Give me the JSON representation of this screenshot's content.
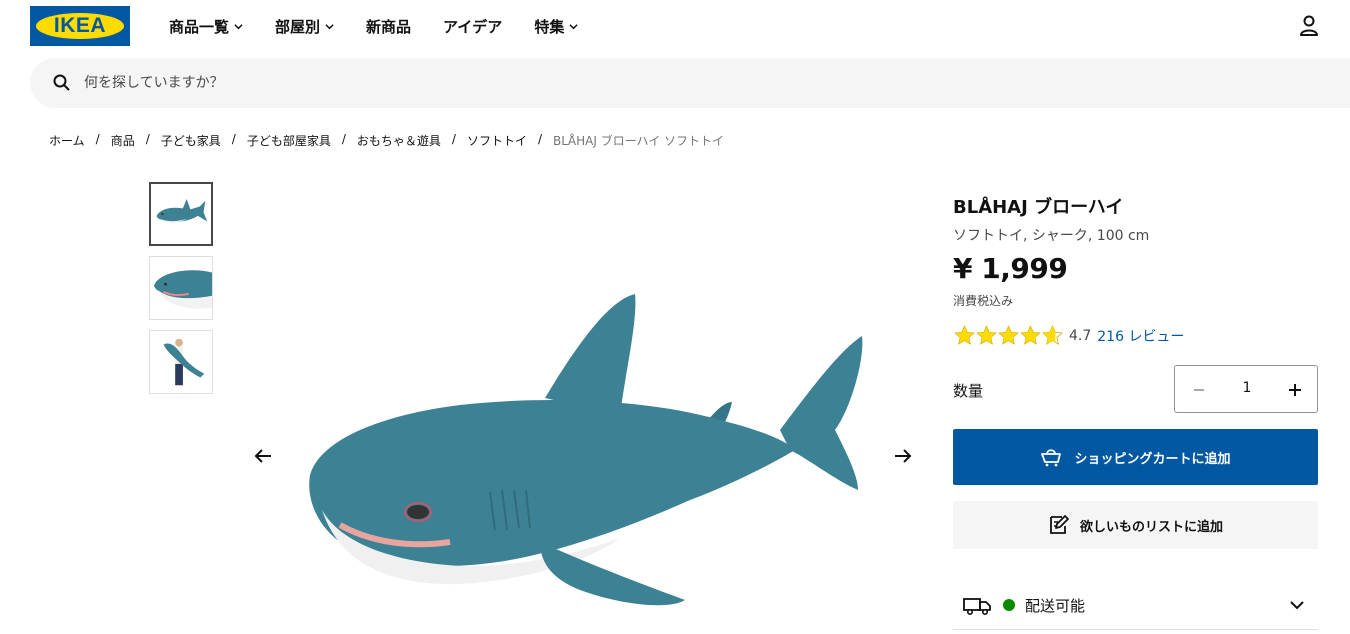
{
  "header": {
    "logo_text": "IKEA",
    "nav": [
      {
        "label": "商品一覧",
        "has_dropdown": true
      },
      {
        "label": "部屋別",
        "has_dropdown": true
      },
      {
        "label": "新商品",
        "has_dropdown": false
      },
      {
        "label": "アイデア",
        "has_dropdown": false
      },
      {
        "label": "特集",
        "has_dropdown": true
      }
    ],
    "user_icon": "user-icon"
  },
  "search": {
    "placeholder": "何を探していますか？",
    "icon": "search-icon"
  },
  "breadcrumb": [
    "ホーム",
    "商品",
    "子ども家具",
    "子ども部屋家具",
    "おもちゃ＆遊具",
    "ソフトトイ",
    "BLÅHAJ ブローハイ ソフトトイ"
  ],
  "gallery": {
    "thumbnails": [
      "shark-side-view",
      "shark-mouth-closeup",
      "person-holding-shark"
    ],
    "active_index": 0,
    "prev_icon": "arrow-left-icon",
    "next_icon": "arrow-right-icon"
  },
  "product": {
    "name": "BLÅHAJ ブローハイ",
    "description": "ソフトトイ, シャーク, 100 cm",
    "price": "¥ 1,999",
    "tax_note": "消費税込み",
    "rating_value": "4.7",
    "rating_stars": 4.7,
    "review_link": "216 レビュー"
  },
  "quantity": {
    "label": "数量",
    "value": "1"
  },
  "actions": {
    "add_to_cart": "ショッピングカートに追加",
    "add_to_wishlist": "欲しいものリストに追加"
  },
  "delivery": {
    "label": "配送可能",
    "status_color": "#0a8a00"
  },
  "colors": {
    "brand_blue": "#0058a3",
    "brand_yellow": "#ffdb00",
    "star": "#ffdb00",
    "shark": "#3d8294"
  }
}
